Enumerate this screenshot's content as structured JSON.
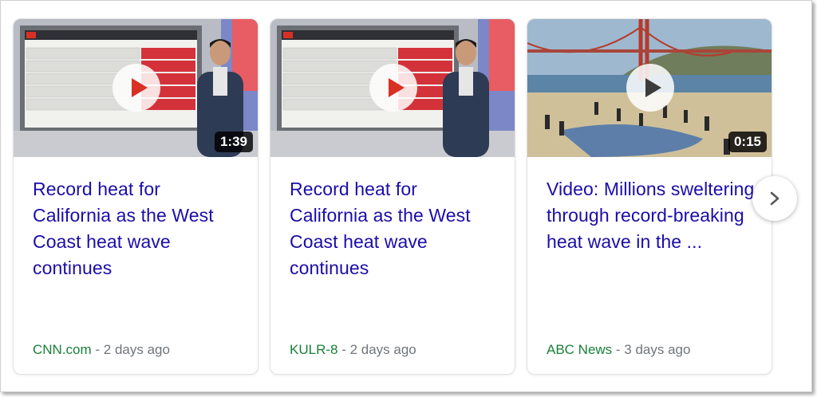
{
  "cards": [
    {
      "title": "Record heat for California as the West Coast heat wave continues",
      "source": "CNN.com",
      "age": " - 2 days ago",
      "duration": "1:39",
      "thumbnail": "news-anchor-weather-board"
    },
    {
      "title": "Record heat for California as the West Coast heat wave continues",
      "source": "KULR-8",
      "age": " - 2 days ago",
      "duration": "",
      "thumbnail": "news-anchor-weather-board"
    },
    {
      "title": "Video: Millions sweltering through record-breaking heat wave in the ...",
      "source": "ABC News",
      "age": " - 3 days ago",
      "duration": "0:15",
      "thumbnail": "golden-gate-beach-crowd"
    }
  ],
  "colors": {
    "title": "#1a0dab",
    "source": "#188038",
    "meta": "#70757a",
    "play_red": "#d93025"
  },
  "icons": {
    "play": "play-icon",
    "next": "chevron-right-icon"
  }
}
